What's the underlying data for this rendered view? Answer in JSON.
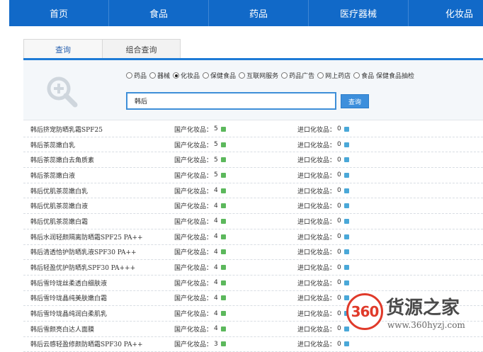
{
  "nav": {
    "items": [
      "首页",
      "食品",
      "药品",
      "医疗器械",
      "化妆品"
    ]
  },
  "tabs": {
    "active": "查询",
    "other": "组合查询"
  },
  "search": {
    "options": [
      "药品",
      "器械",
      "化妆品",
      "保健食品",
      "互联网服务",
      "药品广告",
      "网上药店",
      "食品 保健食品抽检"
    ],
    "selected_option": "化妆品",
    "query": "韩后",
    "button_label": "查询"
  },
  "results": {
    "domestic_label": "国产化妆品：",
    "import_label": "进口化妆品：",
    "rows": [
      {
        "name": "韩后挤宠防晒乳霜SPF25",
        "domestic": "5",
        "import": "0"
      },
      {
        "name": "韩后茶蕊嫩白乳",
        "domestic": "5",
        "import": "0"
      },
      {
        "name": "韩后茶蕊嫩白去角质素",
        "domestic": "5",
        "import": "0"
      },
      {
        "name": "韩后茶蕊嫩白液",
        "domestic": "5",
        "import": "0"
      },
      {
        "name": "韩后优肌茶蕊嫩白乳",
        "domestic": "4",
        "import": "0"
      },
      {
        "name": "韩后优肌茶蕊嫩白液",
        "domestic": "4",
        "import": "0"
      },
      {
        "name": "韩后优肌茶蕊嫩白霜",
        "domestic": "4",
        "import": "0"
      },
      {
        "name": "韩后水润轻颜隔离防晒霜SPF25 PA++",
        "domestic": "4",
        "import": "0"
      },
      {
        "name": "韩后清透恰护防晒乳液SPF30 PA++",
        "domestic": "4",
        "import": "0"
      },
      {
        "name": "韩后轻盈优护防晒乳SPF30 PA+++",
        "domestic": "4",
        "import": "0"
      },
      {
        "name": "韩后雪玲珑丝柔透白细肤液",
        "domestic": "4",
        "import": "0"
      },
      {
        "name": "韩后雪玲珑晶纯美肤嫩白霜",
        "domestic": "4",
        "import": "0"
      },
      {
        "name": "韩后雪玲珑晶纯润白柔肌乳",
        "domestic": "4",
        "import": "0"
      },
      {
        "name": "韩后雪颜亮白达人面膜",
        "domestic": "4",
        "import": "0"
      },
      {
        "name": "韩后云感轻盈修颜防晒霜SPF30 PA++",
        "domestic": "3",
        "import": "0"
      }
    ]
  },
  "watermark": {
    "logo_text": "360",
    "title": "货源之家",
    "url": "www.360hyzj.com"
  },
  "colors": {
    "nav_bg": "#1169c8",
    "accent": "#3d8fdc",
    "green_marker": "#5cb85c",
    "blue_marker": "#4aa8d8",
    "logo_red": "#e03a2a"
  }
}
